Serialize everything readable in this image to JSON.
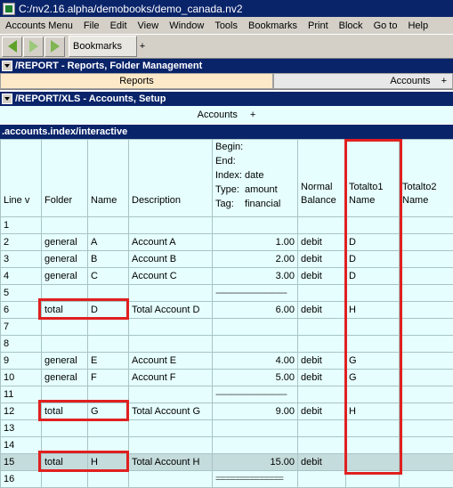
{
  "window": {
    "title": "C:/nv2.16.alpha/demobooks/demo_canada.nv2"
  },
  "menu": [
    "Accounts Menu",
    "File",
    "Edit",
    "View",
    "Window",
    "Tools",
    "Bookmarks",
    "Print",
    "Block",
    "Go to",
    "Help"
  ],
  "toolbar": {
    "bookmarks_label": "Bookmarks",
    "plus": "+"
  },
  "sections": {
    "report": "/REPORT - Reports, Folder Management",
    "xls": "/REPORT/XLS - Accounts, Setup",
    "index": ".accounts.index/interactive"
  },
  "tabs1": {
    "reports": "Reports",
    "accounts": "Accounts",
    "plus": "+"
  },
  "tabs2": {
    "accounts": "Accounts",
    "plus": "+"
  },
  "table": {
    "headers": {
      "line": "Line v",
      "folder": "Folder",
      "name": "Name",
      "description": "Description",
      "tag": "Begin:\nEnd:\nIndex: date\nType:  amount\nTag:    financial",
      "normal_balance": "Normal\nBalance",
      "totalto1": "Totalto1\nName",
      "totalto2": "Totalto2\nName"
    },
    "rows": [
      {
        "line": "1",
        "folder": "",
        "name": "",
        "desc": "",
        "amount": "",
        "bal": "",
        "t1": "",
        "t2": ""
      },
      {
        "line": "2",
        "folder": "general",
        "name": "A",
        "desc": "Account A",
        "amount": "1.00",
        "bal": "debit",
        "t1": "D",
        "t2": ""
      },
      {
        "line": "3",
        "folder": "general",
        "name": "B",
        "desc": "Account B",
        "amount": "2.00",
        "bal": "debit",
        "t1": "D",
        "t2": ""
      },
      {
        "line": "4",
        "folder": "general",
        "name": "C",
        "desc": "Account C",
        "amount": "3.00",
        "bal": "debit",
        "t1": "D",
        "t2": ""
      },
      {
        "line": "5",
        "folder": "",
        "name": "",
        "desc": "",
        "amount": "------------------------------",
        "bal": "",
        "t1": "",
        "t2": ""
      },
      {
        "line": "6",
        "folder": "total",
        "name": "D",
        "desc": "Total Account D",
        "amount": "6.00",
        "bal": "debit",
        "t1": "H",
        "t2": ""
      },
      {
        "line": "7",
        "folder": "",
        "name": "",
        "desc": "",
        "amount": "",
        "bal": "",
        "t1": "",
        "t2": ""
      },
      {
        "line": "8",
        "folder": "",
        "name": "",
        "desc": "",
        "amount": "",
        "bal": "",
        "t1": "",
        "t2": ""
      },
      {
        "line": "9",
        "folder": "general",
        "name": "E",
        "desc": "Account E",
        "amount": "4.00",
        "bal": "debit",
        "t1": "G",
        "t2": ""
      },
      {
        "line": "10",
        "folder": "general",
        "name": "F",
        "desc": "Account F",
        "amount": "5.00",
        "bal": "debit",
        "t1": "G",
        "t2": ""
      },
      {
        "line": "11",
        "folder": "",
        "name": "",
        "desc": "",
        "amount": "------------------------------",
        "bal": "",
        "t1": "",
        "t2": ""
      },
      {
        "line": "12",
        "folder": "total",
        "name": "G",
        "desc": "Total Account G",
        "amount": "9.00",
        "bal": "debit",
        "t1": "H",
        "t2": ""
      },
      {
        "line": "13",
        "folder": "",
        "name": "",
        "desc": "",
        "amount": "",
        "bal": "",
        "t1": "",
        "t2": ""
      },
      {
        "line": "14",
        "folder": "",
        "name": "",
        "desc": "",
        "amount": "",
        "bal": "",
        "t1": "",
        "t2": ""
      },
      {
        "line": "15",
        "folder": "total",
        "name": "H",
        "desc": "Total Account H",
        "amount": "15.00",
        "bal": "debit",
        "t1": "",
        "t2": ""
      },
      {
        "line": "16",
        "folder": "",
        "name": "",
        "desc": "",
        "amount": "==============",
        "bal": "",
        "t1": "",
        "t2": ""
      }
    ],
    "selected_row_line": "15"
  },
  "colors": {
    "highlight": "#e02020",
    "title_bar": "#0a246a",
    "grid_bg": "#e6fffe"
  }
}
